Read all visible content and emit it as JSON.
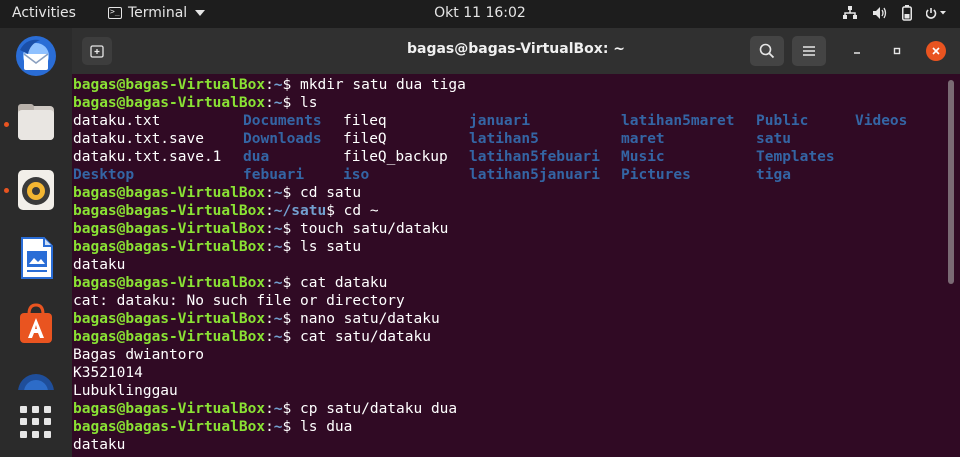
{
  "topbar": {
    "activities": "Activities",
    "app_menu": "Terminal",
    "clock": "Okt 11  16:02"
  },
  "window": {
    "title": "bagas@bagas-VirtualBox: ~"
  },
  "terminal": {
    "lines": [
      {
        "type": "prompt",
        "user": "bagas@bagas-VirtualBox",
        "path": "~",
        "cmd": "mkdir satu dua tiga"
      },
      {
        "type": "prompt",
        "user": "bagas@bagas-VirtualBox",
        "path": "~",
        "cmd": "ls"
      },
      {
        "type": "ls",
        "cells": [
          {
            "t": "dataku.txt",
            "k": "file"
          },
          {
            "t": "Documents",
            "k": "dir"
          },
          {
            "t": "fileq",
            "k": "file"
          },
          {
            "t": "januari",
            "k": "dir"
          },
          {
            "t": "latihan5maret",
            "k": "dir"
          },
          {
            "t": "Public",
            "k": "dir"
          },
          {
            "t": "Videos",
            "k": "dir"
          }
        ]
      },
      {
        "type": "ls",
        "cells": [
          {
            "t": "dataku.txt.save",
            "k": "file"
          },
          {
            "t": "Downloads",
            "k": "dir"
          },
          {
            "t": "fileQ",
            "k": "file"
          },
          {
            "t": "latihan5",
            "k": "dir"
          },
          {
            "t": "maret",
            "k": "dir"
          },
          {
            "t": "satu",
            "k": "dir"
          }
        ]
      },
      {
        "type": "ls",
        "cells": [
          {
            "t": "dataku.txt.save.1",
            "k": "file"
          },
          {
            "t": "dua",
            "k": "dir"
          },
          {
            "t": "fileQ_backup",
            "k": "file"
          },
          {
            "t": "latihan5febuari",
            "k": "dir"
          },
          {
            "t": "Music",
            "k": "dir"
          },
          {
            "t": "Templates",
            "k": "dir"
          }
        ]
      },
      {
        "type": "ls",
        "cells": [
          {
            "t": "Desktop",
            "k": "dir"
          },
          {
            "t": "febuari",
            "k": "dir"
          },
          {
            "t": "iso",
            "k": "dir"
          },
          {
            "t": "latihan5januari",
            "k": "dir"
          },
          {
            "t": "Pictures",
            "k": "dir"
          },
          {
            "t": "tiga",
            "k": "dir"
          }
        ]
      },
      {
        "type": "prompt",
        "user": "bagas@bagas-VirtualBox",
        "path": "~",
        "cmd": "cd satu"
      },
      {
        "type": "prompt",
        "user": "bagas@bagas-VirtualBox",
        "path": "~/satu",
        "cmd": "cd ~"
      },
      {
        "type": "prompt",
        "user": "bagas@bagas-VirtualBox",
        "path": "~",
        "cmd": "touch satu/dataku"
      },
      {
        "type": "prompt",
        "user": "bagas@bagas-VirtualBox",
        "path": "~",
        "cmd": "ls satu"
      },
      {
        "type": "out",
        "text": "dataku"
      },
      {
        "type": "prompt",
        "user": "bagas@bagas-VirtualBox",
        "path": "~",
        "cmd": "cat dataku"
      },
      {
        "type": "out",
        "text": "cat: dataku: No such file or directory"
      },
      {
        "type": "prompt",
        "user": "bagas@bagas-VirtualBox",
        "path": "~",
        "cmd": "nano satu/dataku"
      },
      {
        "type": "prompt",
        "user": "bagas@bagas-VirtualBox",
        "path": "~",
        "cmd": "cat satu/dataku"
      },
      {
        "type": "out",
        "text": "Bagas dwiantoro"
      },
      {
        "type": "out",
        "text": "K3521014"
      },
      {
        "type": "out",
        "text": "Lubuklinggau"
      },
      {
        "type": "prompt",
        "user": "bagas@bagas-VirtualBox",
        "path": "~",
        "cmd": "cp satu/dataku dua"
      },
      {
        "type": "prompt",
        "user": "bagas@bagas-VirtualBox",
        "path": "~",
        "cmd": "ls dua"
      },
      {
        "type": "out",
        "text": "dataku"
      }
    ]
  },
  "dock": {
    "items": [
      "thunderbird-icon",
      "files-icon",
      "rhythmbox-icon",
      "writer-icon",
      "software-icon",
      "help-icon"
    ]
  },
  "colors": {
    "terminal_bg": "#300a24",
    "prompt_user": "#8ae234",
    "prompt_path": "#729fcf",
    "dir": "#3465a4",
    "accent": "#e95420"
  }
}
